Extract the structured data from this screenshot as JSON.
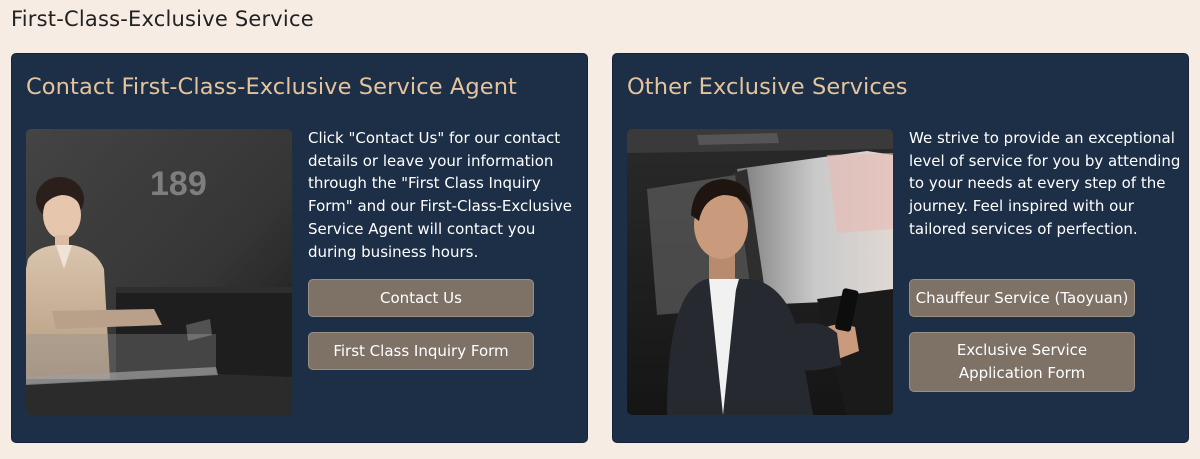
{
  "page": {
    "title": "First-Class-Exclusive Service"
  },
  "contact_card": {
    "title": "Contact First-Class-Exclusive Service Agent",
    "photo_label": "189",
    "description": "Click \"Contact Us\" for our contact details or leave your information through the \"First Class Inquiry Form\" and our First-Class-Exclusive Service Agent will contact you during business hours.",
    "buttons": {
      "contact": "Contact Us",
      "inquiry": "First Class Inquiry Form"
    }
  },
  "services_card": {
    "title": "Other Exclusive Services",
    "description": "We strive to provide an exceptional level of service for you by attending to your needs at every step of the journey. Feel inspired with our tailored services of perfection.",
    "buttons": {
      "chauffeur": "Chauffeur Service (Taoyuan)",
      "application": "Exclusive Service Application Form"
    }
  },
  "colors": {
    "page_background": "#f6ece3",
    "card_background": "#1d2f47",
    "card_title": "#e5c49d",
    "button_background": "#7e7267"
  }
}
